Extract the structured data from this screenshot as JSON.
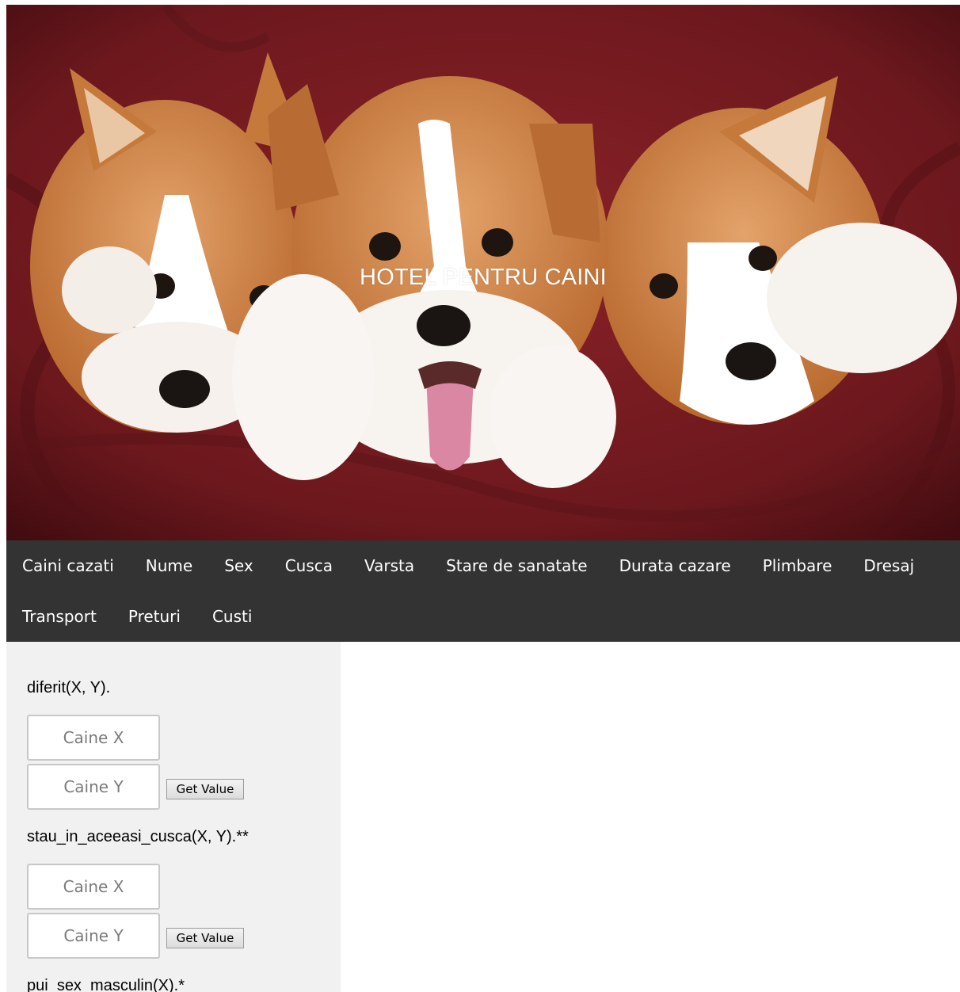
{
  "hero": {
    "title": "HOTEL PENTRU CAINI",
    "image": "three-corgi-puppies-photo"
  },
  "nav": {
    "row1": [
      "Caini cazati",
      "Nume",
      "Sex",
      "Cusca",
      "Varsta",
      "Stare de sanatate",
      "Durata cazare",
      "Plimbare",
      "Dresaj"
    ],
    "row2": [
      "Transport",
      "Preturi",
      "Custi"
    ]
  },
  "queries": [
    {
      "label": "diferit(X, Y).",
      "field_x": {
        "placeholder": "Caine X",
        "value": ""
      },
      "field_y": {
        "placeholder": "Caine Y",
        "value": ""
      },
      "button": "Get Value"
    },
    {
      "label": "stau_in_aceeasi_cusca(X, Y).**",
      "field_x": {
        "placeholder": "Caine X",
        "value": ""
      },
      "field_y": {
        "placeholder": "Caine Y",
        "value": ""
      },
      "button": "Get Value"
    },
    {
      "label": "pui_sex_masculin(X).*"
    }
  ],
  "colors": {
    "nav_bg": "#333333",
    "sidebar_bg": "#f1f1f1",
    "hero_fabric": "#6e1a1f"
  }
}
